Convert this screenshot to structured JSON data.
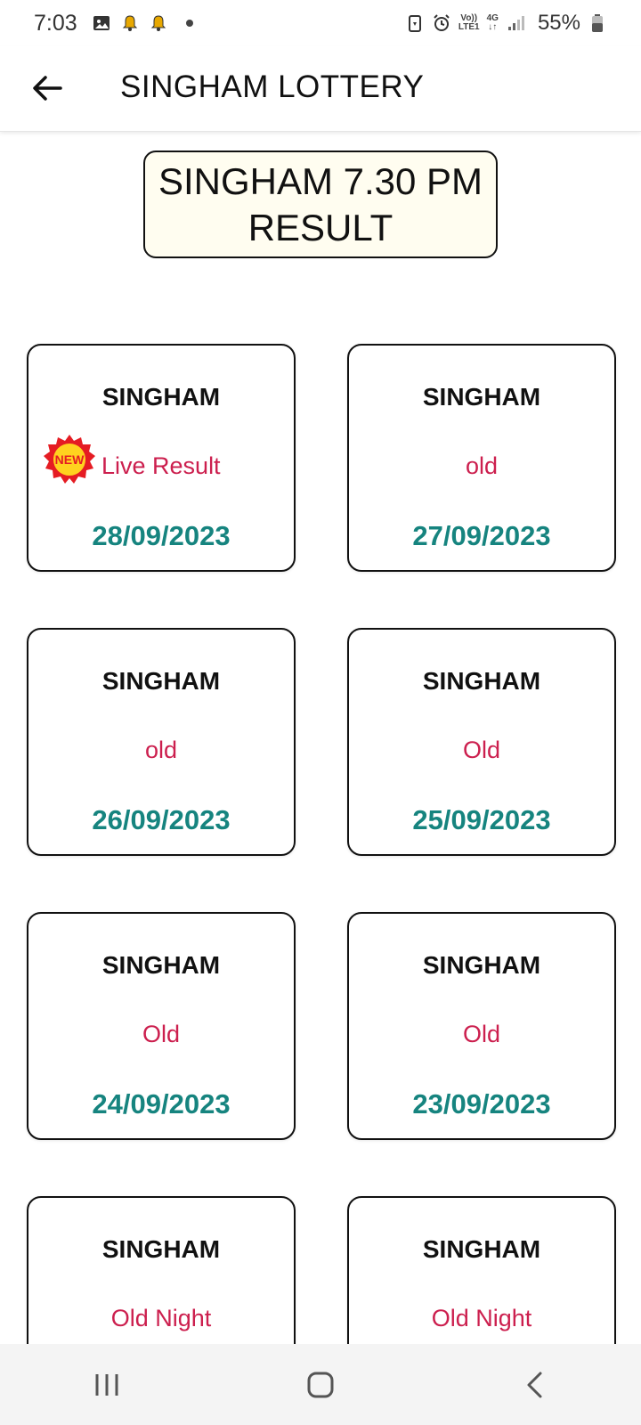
{
  "status_bar": {
    "time": "7:03",
    "network_top": "Vo))",
    "network_bottom": "LTE1",
    "net_type_top": "4G",
    "net_type_bottom": "↓↑",
    "battery": "55%"
  },
  "app_bar": {
    "title": "SINGHAM LOTTERY"
  },
  "heading": {
    "line1": "SINGHAM 7.30 PM",
    "line2": "RESULT"
  },
  "badge": {
    "text": "NEW"
  },
  "cards": [
    {
      "title": "SINGHAM",
      "status": "Live Result",
      "date": "28/09/2023"
    },
    {
      "title": "SINGHAM",
      "status": "old",
      "date": "27/09/2023"
    },
    {
      "title": "SINGHAM",
      "status": "old",
      "date": "26/09/2023"
    },
    {
      "title": "SINGHAM",
      "status": "Old",
      "date": "25/09/2023"
    },
    {
      "title": "SINGHAM",
      "status": "Old",
      "date": "24/09/2023"
    },
    {
      "title": "SINGHAM",
      "status": "Old",
      "date": "23/09/2023"
    },
    {
      "title": "SINGHAM",
      "status": "Old Night",
      "date": ""
    },
    {
      "title": "SINGHAM",
      "status": "Old Night",
      "date": ""
    }
  ],
  "colors": {
    "status_red": "#cc1f4e",
    "date_teal": "#16847f",
    "heading_bg": "#fffdf0",
    "badge_red": "#e51c23",
    "badge_yellow": "#ffd21f"
  },
  "icons": {
    "back": "arrow-left-icon",
    "gallery": "image-icon",
    "alarm": "alarm-icon",
    "nav_recents": "recent-apps-icon",
    "nav_home": "home-icon",
    "nav_back": "chevron-left-icon"
  }
}
